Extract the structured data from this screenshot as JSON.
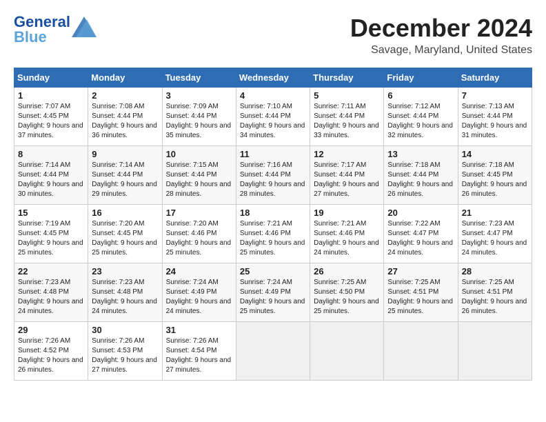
{
  "header": {
    "logo_line1": "General",
    "logo_line2": "Blue",
    "month": "December 2024",
    "location": "Savage, Maryland, United States"
  },
  "columns": [
    "Sunday",
    "Monday",
    "Tuesday",
    "Wednesday",
    "Thursday",
    "Friday",
    "Saturday"
  ],
  "weeks": [
    [
      {
        "day": "1",
        "sunrise": "Sunrise: 7:07 AM",
        "sunset": "Sunset: 4:45 PM",
        "daylight": "Daylight: 9 hours and 37 minutes."
      },
      {
        "day": "2",
        "sunrise": "Sunrise: 7:08 AM",
        "sunset": "Sunset: 4:44 PM",
        "daylight": "Daylight: 9 hours and 36 minutes."
      },
      {
        "day": "3",
        "sunrise": "Sunrise: 7:09 AM",
        "sunset": "Sunset: 4:44 PM",
        "daylight": "Daylight: 9 hours and 35 minutes."
      },
      {
        "day": "4",
        "sunrise": "Sunrise: 7:10 AM",
        "sunset": "Sunset: 4:44 PM",
        "daylight": "Daylight: 9 hours and 34 minutes."
      },
      {
        "day": "5",
        "sunrise": "Sunrise: 7:11 AM",
        "sunset": "Sunset: 4:44 PM",
        "daylight": "Daylight: 9 hours and 33 minutes."
      },
      {
        "day": "6",
        "sunrise": "Sunrise: 7:12 AM",
        "sunset": "Sunset: 4:44 PM",
        "daylight": "Daylight: 9 hours and 32 minutes."
      },
      {
        "day": "7",
        "sunrise": "Sunrise: 7:13 AM",
        "sunset": "Sunset: 4:44 PM",
        "daylight": "Daylight: 9 hours and 31 minutes."
      }
    ],
    [
      {
        "day": "8",
        "sunrise": "Sunrise: 7:14 AM",
        "sunset": "Sunset: 4:44 PM",
        "daylight": "Daylight: 9 hours and 30 minutes."
      },
      {
        "day": "9",
        "sunrise": "Sunrise: 7:14 AM",
        "sunset": "Sunset: 4:44 PM",
        "daylight": "Daylight: 9 hours and 29 minutes."
      },
      {
        "day": "10",
        "sunrise": "Sunrise: 7:15 AM",
        "sunset": "Sunset: 4:44 PM",
        "daylight": "Daylight: 9 hours and 28 minutes."
      },
      {
        "day": "11",
        "sunrise": "Sunrise: 7:16 AM",
        "sunset": "Sunset: 4:44 PM",
        "daylight": "Daylight: 9 hours and 28 minutes."
      },
      {
        "day": "12",
        "sunrise": "Sunrise: 7:17 AM",
        "sunset": "Sunset: 4:44 PM",
        "daylight": "Daylight: 9 hours and 27 minutes."
      },
      {
        "day": "13",
        "sunrise": "Sunrise: 7:18 AM",
        "sunset": "Sunset: 4:44 PM",
        "daylight": "Daylight: 9 hours and 26 minutes."
      },
      {
        "day": "14",
        "sunrise": "Sunrise: 7:18 AM",
        "sunset": "Sunset: 4:45 PM",
        "daylight": "Daylight: 9 hours and 26 minutes."
      }
    ],
    [
      {
        "day": "15",
        "sunrise": "Sunrise: 7:19 AM",
        "sunset": "Sunset: 4:45 PM",
        "daylight": "Daylight: 9 hours and 25 minutes."
      },
      {
        "day": "16",
        "sunrise": "Sunrise: 7:20 AM",
        "sunset": "Sunset: 4:45 PM",
        "daylight": "Daylight: 9 hours and 25 minutes."
      },
      {
        "day": "17",
        "sunrise": "Sunrise: 7:20 AM",
        "sunset": "Sunset: 4:46 PM",
        "daylight": "Daylight: 9 hours and 25 minutes."
      },
      {
        "day": "18",
        "sunrise": "Sunrise: 7:21 AM",
        "sunset": "Sunset: 4:46 PM",
        "daylight": "Daylight: 9 hours and 25 minutes."
      },
      {
        "day": "19",
        "sunrise": "Sunrise: 7:21 AM",
        "sunset": "Sunset: 4:46 PM",
        "daylight": "Daylight: 9 hours and 24 minutes."
      },
      {
        "day": "20",
        "sunrise": "Sunrise: 7:22 AM",
        "sunset": "Sunset: 4:47 PM",
        "daylight": "Daylight: 9 hours and 24 minutes."
      },
      {
        "day": "21",
        "sunrise": "Sunrise: 7:23 AM",
        "sunset": "Sunset: 4:47 PM",
        "daylight": "Daylight: 9 hours and 24 minutes."
      }
    ],
    [
      {
        "day": "22",
        "sunrise": "Sunrise: 7:23 AM",
        "sunset": "Sunset: 4:48 PM",
        "daylight": "Daylight: 9 hours and 24 minutes."
      },
      {
        "day": "23",
        "sunrise": "Sunrise: 7:23 AM",
        "sunset": "Sunset: 4:48 PM",
        "daylight": "Daylight: 9 hours and 24 minutes."
      },
      {
        "day": "24",
        "sunrise": "Sunrise: 7:24 AM",
        "sunset": "Sunset: 4:49 PM",
        "daylight": "Daylight: 9 hours and 24 minutes."
      },
      {
        "day": "25",
        "sunrise": "Sunrise: 7:24 AM",
        "sunset": "Sunset: 4:49 PM",
        "daylight": "Daylight: 9 hours and 25 minutes."
      },
      {
        "day": "26",
        "sunrise": "Sunrise: 7:25 AM",
        "sunset": "Sunset: 4:50 PM",
        "daylight": "Daylight: 9 hours and 25 minutes."
      },
      {
        "day": "27",
        "sunrise": "Sunrise: 7:25 AM",
        "sunset": "Sunset: 4:51 PM",
        "daylight": "Daylight: 9 hours and 25 minutes."
      },
      {
        "day": "28",
        "sunrise": "Sunrise: 7:25 AM",
        "sunset": "Sunset: 4:51 PM",
        "daylight": "Daylight: 9 hours and 26 minutes."
      }
    ],
    [
      {
        "day": "29",
        "sunrise": "Sunrise: 7:26 AM",
        "sunset": "Sunset: 4:52 PM",
        "daylight": "Daylight: 9 hours and 26 minutes."
      },
      {
        "day": "30",
        "sunrise": "Sunrise: 7:26 AM",
        "sunset": "Sunset: 4:53 PM",
        "daylight": "Daylight: 9 hours and 27 minutes."
      },
      {
        "day": "31",
        "sunrise": "Sunrise: 7:26 AM",
        "sunset": "Sunset: 4:54 PM",
        "daylight": "Daylight: 9 hours and 27 minutes."
      },
      null,
      null,
      null,
      null
    ]
  ]
}
